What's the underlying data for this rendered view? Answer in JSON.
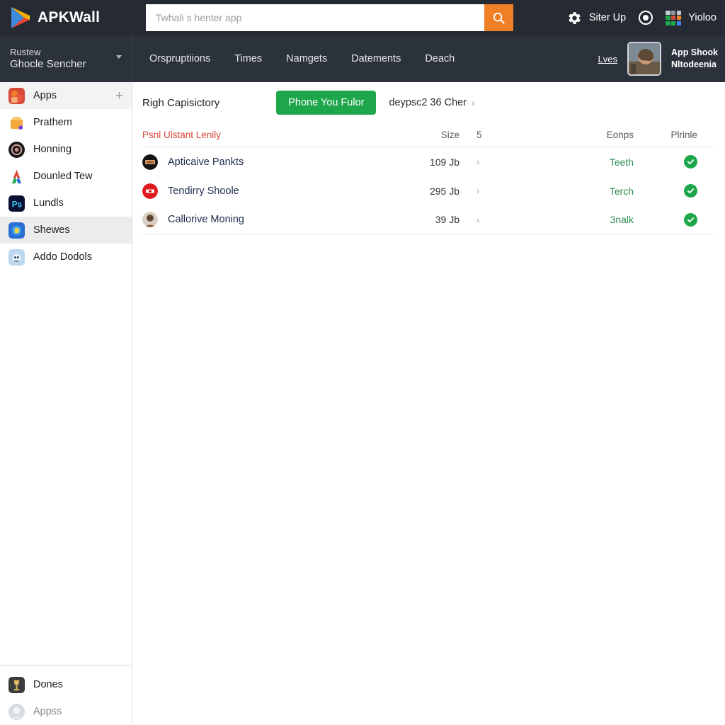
{
  "header": {
    "brand": "APKWall",
    "brand_first": "APK",
    "brand_second": "Wall",
    "search_placeholder": "Twhali s henter app",
    "search_value": "",
    "search_icon": "search-icon",
    "gear_icon": "gear-icon",
    "settings_label": "Siter Up",
    "record_icon": "record-circle-icon",
    "grid_icon": "app-grid-icon",
    "grid_label": "Yioloo",
    "background": "#262b33",
    "accent_orange": "#f08026"
  },
  "navbar": {
    "account_top": "Rustew",
    "account_sub": "Ghocle Sencher",
    "chevron_icon": "chevron-down-icon",
    "links": [
      {
        "label": "Orspruptiions"
      },
      {
        "label": "Times"
      },
      {
        "label": "Namgets"
      },
      {
        "label": "Datements"
      },
      {
        "label": "Deach"
      }
    ],
    "lves_link": "Lves",
    "profile_name_line1": "App Shook",
    "profile_name_line2": "Nltodeenia",
    "background": "#2b323c"
  },
  "sidebar": {
    "apps_label": "Apps",
    "add_label": "+",
    "items": [
      {
        "label": "Prathem"
      },
      {
        "label": "Honning"
      },
      {
        "label": "Dounled Tew"
      },
      {
        "label": "Lundls"
      },
      {
        "label": "Shewes"
      },
      {
        "label": "Addo Dodols"
      }
    ],
    "bottom_items": [
      {
        "label": "Dones"
      },
      {
        "label": "Appss"
      }
    ],
    "active_label": "Shewes"
  },
  "main": {
    "title": "Righ Capisictory",
    "primary_button": "Phone You Fulor",
    "breadcrumb": "deypsc2 36 Cher",
    "breadcrumb_chevron": "chevron-right-icon",
    "primary_color": "#1ea74a",
    "columns": {
      "name": "Psnl Ulstant Lenily",
      "size": "Size",
      "num": "5",
      "eonps": "Eonps",
      "plrinle": "Plrinle"
    },
    "rows": [
      {
        "name": "Apticaive Pankts",
        "size": "109 Jb",
        "chevron": "›",
        "eonps": "Teeth",
        "status_icon": "check-circle-icon"
      },
      {
        "name": "Tendirry Shoole",
        "size": "295 Jb",
        "chevron": "›",
        "eonps": "Terch",
        "status_icon": "check-circle-icon"
      },
      {
        "name": "Callorive Moning",
        "size": "39 Jb",
        "chevron": "›",
        "eonps": "3nalk",
        "status_icon": "check-circle-icon"
      }
    ]
  }
}
